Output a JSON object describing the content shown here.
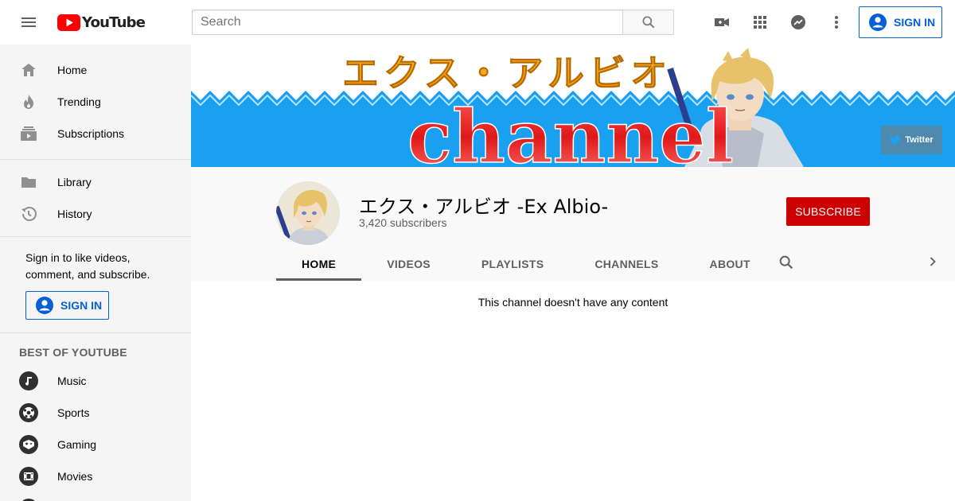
{
  "header": {
    "logo_text": "YouTube",
    "search": {
      "placeholder": "Search",
      "value": ""
    },
    "signin_label": "SIGN IN",
    "icons": [
      "menu-icon",
      "search-icon",
      "create-video-icon",
      "apps-grid-icon",
      "messages-icon",
      "more-vert-icon",
      "account-icon"
    ]
  },
  "sidebar": {
    "main": [
      {
        "label": "Home",
        "icon": "home-icon"
      },
      {
        "label": "Trending",
        "icon": "trending-icon"
      },
      {
        "label": "Subscriptions",
        "icon": "subscriptions-icon"
      }
    ],
    "library": [
      {
        "label": "Library",
        "icon": "library-icon"
      },
      {
        "label": "History",
        "icon": "history-icon"
      }
    ],
    "signin_message": "Sign in to like videos, comment, and subscribe.",
    "signin_label": "SIGN IN",
    "best_title": "BEST OF YOUTUBE",
    "best": [
      {
        "label": "Music",
        "icon": "music-icon"
      },
      {
        "label": "Sports",
        "icon": "sports-icon"
      },
      {
        "label": "Gaming",
        "icon": "gaming-icon"
      },
      {
        "label": "Movies",
        "icon": "movies-icon"
      }
    ]
  },
  "banner": {
    "title_jp": "エクス・アルビオ",
    "title_en": "channel",
    "twitter_label": "Twitter"
  },
  "channel": {
    "name": "エクス・アルビオ -Ex Albio-",
    "subscribers": "3,420 subscribers",
    "subscribe_label": "SUBSCRIBE",
    "tabs": [
      "HOME",
      "VIDEOS",
      "PLAYLISTS",
      "CHANNELS",
      "ABOUT"
    ],
    "active_tab": "HOME"
  },
  "content": {
    "empty_message": "This channel doesn't have any content"
  },
  "colors": {
    "brand_red": "#ff0000",
    "subscribe_red": "#cc0000",
    "link_blue": "#065fd4",
    "banner_blue": "#1aa0f0"
  }
}
